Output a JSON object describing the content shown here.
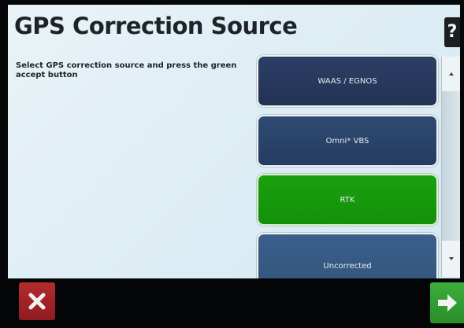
{
  "screen": {
    "title": "GPS Correction Source",
    "help_label": "?",
    "instructions": "Select GPS correction source and press the green accept button"
  },
  "sources": {
    "selected": "RTK",
    "options": [
      {
        "label": "WAAS / EGNOS",
        "color": "#26375c"
      },
      {
        "label": "Omni* VBS",
        "color": "#28406a"
      },
      {
        "label": "RTK",
        "color": "#16990c"
      },
      {
        "label": "Uncorrected",
        "color": "#375b86"
      }
    ]
  },
  "scrollbar": {
    "up_icon": "scroll-up-arrow-icon",
    "down_icon": "scroll-down-arrow-icon"
  },
  "bottom_bar": {
    "cancel_icon": "close-icon",
    "cancel_color": "#a82428",
    "accept_icon": "arrow-right-icon",
    "accept_color": "#34a034"
  }
}
